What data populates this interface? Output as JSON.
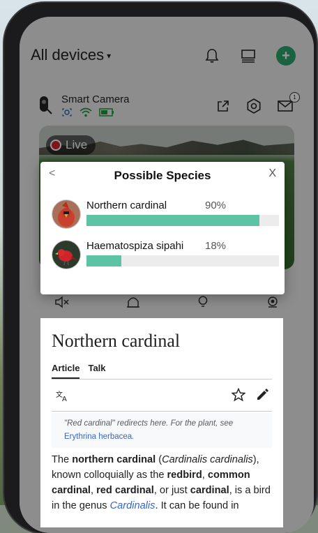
{
  "header": {
    "title": "All devices",
    "caret": "▾",
    "bell_icon": "bell-icon",
    "panel_icon": "panel-icon",
    "add_icon": "+"
  },
  "device": {
    "name": "Smart Camera",
    "notification_count": "1"
  },
  "feed": {
    "live_label": "Live"
  },
  "modal": {
    "back": "<",
    "title": "Possible Species",
    "close": "X",
    "species": [
      {
        "name": "Northern cardinal",
        "percent_text": "90%",
        "percent": 90
      },
      {
        "name": "Haematospiza sipahi",
        "percent_text": "18%",
        "percent": 18
      }
    ]
  },
  "article": {
    "title": "Northern cardinal",
    "tabs": [
      "Article",
      "Talk"
    ],
    "hatnote_prefix": "\"Red cardinal\" redirects here. For the plant, see ",
    "hatnote_link": "Erythrina herbacea",
    "hatnote_suffix": ".",
    "p1": "The ",
    "p2": "northern cardinal",
    "p3": " (",
    "p4": "Cardinalis cardinalis",
    "p5": "), known colloquially as the ",
    "p6": "redbird",
    "p7": ", ",
    "p8": "common cardinal",
    "p9": ", ",
    "p10": "red cardinal",
    "p11": ", or just ",
    "p12": "cardinal",
    "p13": ", is a bird in the genus ",
    "p14": "Cardinalis",
    "p15": ". It can be found in"
  },
  "colors": {
    "bar_fill": "#5cc3a4",
    "bar_track": "#ececec",
    "add_button": "#2ea36d",
    "live_dot": "#d2232a",
    "link": "#3366cc"
  }
}
